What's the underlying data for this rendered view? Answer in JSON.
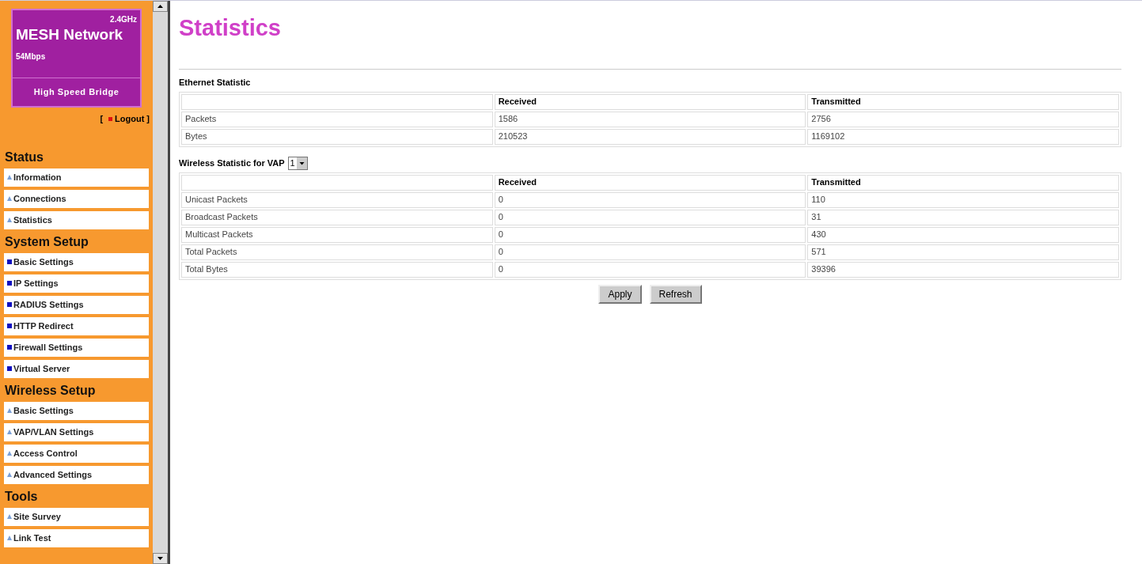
{
  "logo": {
    "band": "2.4GHz",
    "title": "MESH Network",
    "speed": "54Mbps",
    "subtitle": "High Speed Bridge"
  },
  "logout": {
    "open": "[",
    "label": "Logout",
    "close": "]"
  },
  "sidebar": [
    {
      "title": "Status",
      "kind": "arrow",
      "items": [
        {
          "label": "Information"
        },
        {
          "label": "Connections"
        },
        {
          "label": "Statistics"
        }
      ]
    },
    {
      "title": "System Setup",
      "kind": "square",
      "items": [
        {
          "label": "Basic Settings"
        },
        {
          "label": "IP Settings"
        },
        {
          "label": "RADIUS Settings"
        },
        {
          "label": "HTTP Redirect"
        },
        {
          "label": "Firewall Settings"
        },
        {
          "label": "Virtual Server"
        }
      ]
    },
    {
      "title": "Wireless Setup",
      "kind": "arrow",
      "items": [
        {
          "label": "Basic Settings"
        },
        {
          "label": "VAP/VLAN Settings"
        },
        {
          "label": "Access Control"
        },
        {
          "label": "Advanced Settings"
        }
      ]
    },
    {
      "title": "Tools",
      "kind": "arrow",
      "items": [
        {
          "label": "Site Survey"
        },
        {
          "label": "Link Test"
        }
      ]
    }
  ],
  "page_title": "Statistics",
  "ethernet": {
    "heading": "Ethernet Statistic",
    "columns": [
      "",
      "Received",
      "Transmitted"
    ],
    "rows": [
      [
        "Packets",
        "1586",
        "2756"
      ],
      [
        "Bytes",
        "210523",
        "1169102"
      ]
    ]
  },
  "wireless": {
    "heading": "Wireless Statistic for VAP",
    "vap": "1",
    "columns": [
      "",
      "Received",
      "Transmitted"
    ],
    "rows": [
      [
        "Unicast Packets",
        "0",
        "110"
      ],
      [
        "Broadcast Packets",
        "0",
        "31"
      ],
      [
        "Multicast Packets",
        "0",
        "430"
      ],
      [
        "Total Packets",
        "0",
        "571"
      ],
      [
        "Total Bytes",
        "0",
        "39396"
      ]
    ]
  },
  "buttons": [
    "Apply",
    "Refresh"
  ]
}
